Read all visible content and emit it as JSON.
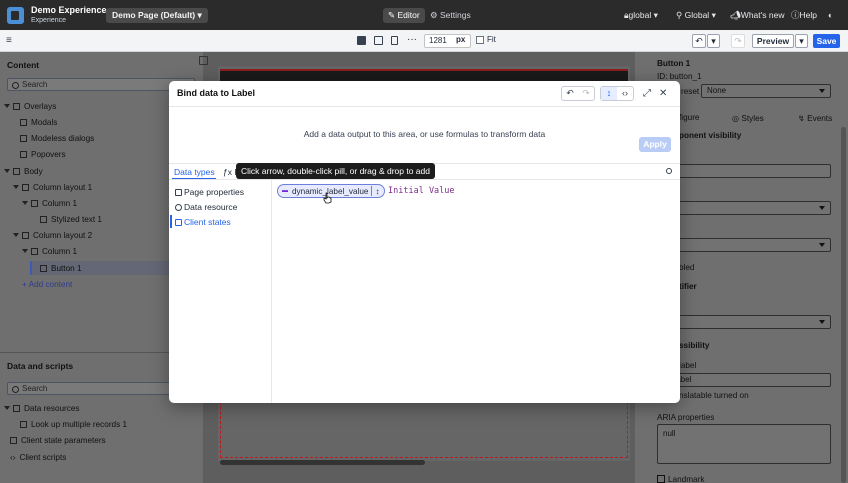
{
  "topbar": {
    "app_title": "Demo Experience",
    "app_subtitle": "Experience",
    "page_select": "Demo Page (Default)",
    "editor_label": "Editor",
    "settings_label": "Settings",
    "scope": "global",
    "app_scope": "Global",
    "whats_new": "What's new",
    "help": "Help"
  },
  "toolbar": {
    "width_value": "1281",
    "width_unit": "px",
    "fit_label": "Fit",
    "preview_label": "Preview",
    "save_label": "Save"
  },
  "left_panel": {
    "content_heading": "Content",
    "search_placeholder": "Search",
    "tree": [
      {
        "label": "Overlays"
      },
      {
        "label": "Modals"
      },
      {
        "label": "Modeless dialogs"
      },
      {
        "label": "Popovers"
      },
      {
        "label": "Body"
      },
      {
        "label": "Column layout 1"
      },
      {
        "label": "Column 1"
      },
      {
        "label": "Stylized text 1"
      },
      {
        "label": "Column layout 2"
      },
      {
        "label": "Column 1"
      },
      {
        "label": "Button 1"
      }
    ],
    "add_content": "Add content",
    "scripts_heading": "Data and scripts",
    "scripts_search_placeholder": "Search",
    "scripts_tree": [
      {
        "label": "Data resources"
      },
      {
        "label": "Look up multiple records 1"
      },
      {
        "label": "Client state parameters"
      },
      {
        "label": "Client scripts"
      }
    ]
  },
  "right_panel": {
    "component_name": "Button 1",
    "component_id": "ID: button_1",
    "preset_label": "reset",
    "preset_value": "None",
    "tab_configure": "figure",
    "tab_styles": "Styles",
    "tab_events": "Events",
    "section_visibility": "ponent visibility",
    "variant_value": "dary",
    "size_value": "m",
    "disabled_label": "bled",
    "section_identifier": "tifier",
    "section_accessibility": "ssibility",
    "aria_label_label": "label",
    "aria_label_value": "r a label",
    "translatable": "nslatable turned on",
    "aria_properties_label": "ARIA properties",
    "aria_properties_value": "null",
    "landmark_label": "Landmark"
  },
  "modal": {
    "title": "Bind data to Label",
    "hint": "Add a data output to this area, or use formulas to transform data",
    "apply_label": "Apply",
    "tab_data_types": "Data types",
    "tab_formulas": "F",
    "data_types": [
      {
        "label": "Page properties"
      },
      {
        "label": "Data resource"
      },
      {
        "label": "Client states"
      }
    ],
    "pill_label": "dynamic_label_value",
    "initial_value": "Initial Value"
  },
  "tooltip": {
    "text": "Click arrow, double-click pill, or drag & drop to add"
  }
}
